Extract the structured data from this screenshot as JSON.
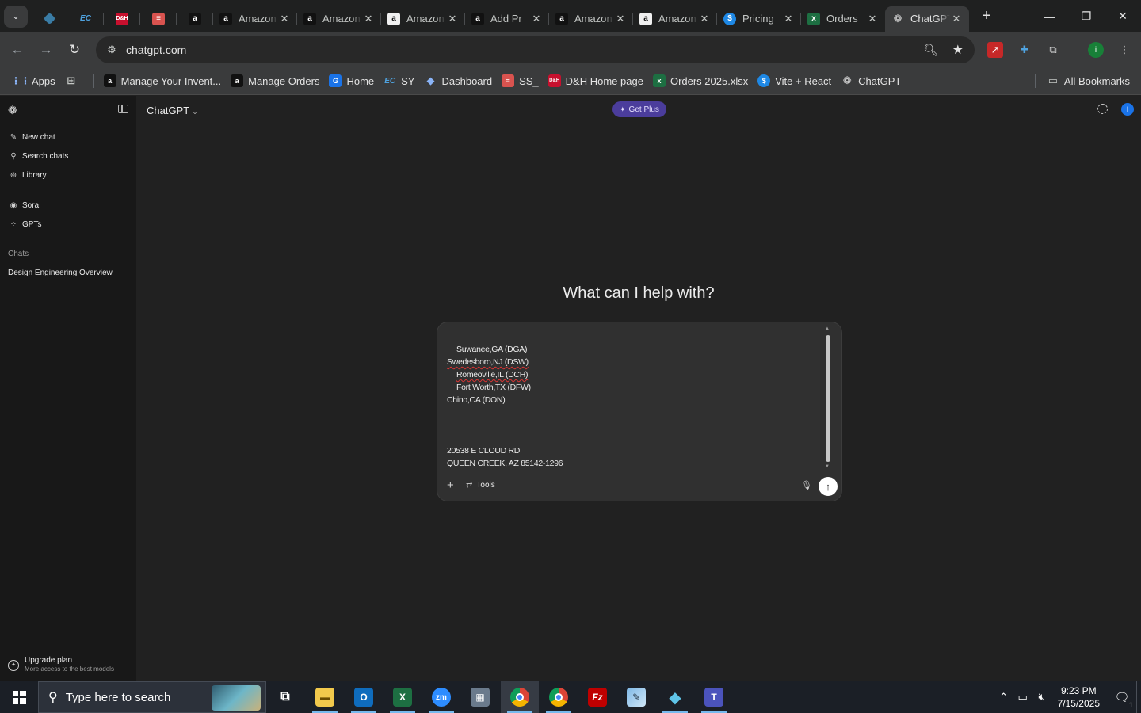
{
  "browser": {
    "tabs": [
      {
        "title": "",
        "favicon": "tab-search",
        "pinned": true
      },
      {
        "title": "",
        "favicon": "blue-diamond",
        "pinned": true
      },
      {
        "title": "",
        "favicon": "EC",
        "pinned": true
      },
      {
        "title": "",
        "favicon": "D&H",
        "pinned": true
      },
      {
        "title": "",
        "favicon": "stack",
        "pinned": true
      },
      {
        "title": "",
        "favicon": "amazon",
        "pinned": true
      },
      {
        "title": "Amazon",
        "favicon": "amazon"
      },
      {
        "title": "Amazon",
        "favicon": "amazon"
      },
      {
        "title": "Amazon",
        "favicon": "amazon"
      },
      {
        "title": "Add Pr",
        "favicon": "amazon"
      },
      {
        "title": "Amazon",
        "favicon": "amazon"
      },
      {
        "title": "Amazon",
        "favicon": "amazon"
      },
      {
        "title": "Pricing",
        "favicon": "dollar"
      },
      {
        "title": "Orders",
        "favicon": "excel"
      },
      {
        "title": "ChatGPT",
        "favicon": "openai",
        "active": true
      }
    ],
    "url": "chatgpt.com",
    "bookmarks": {
      "apps": "Apps",
      "items": [
        "Manage Your Invent...",
        "Manage Orders",
        "Home",
        "SY",
        "Dashboard",
        "SS_",
        "D&H Home page",
        "Orders 2025.xlsx",
        "Vite + React",
        "ChatGPT"
      ],
      "all": "All Bookmarks"
    }
  },
  "sidebar": {
    "items": [
      "New chat",
      "Search chats",
      "Library",
      "Sora",
      "GPTs"
    ],
    "section": "Chats",
    "chats": [
      "Design Engineering Overview"
    ],
    "upgrade_title": "Upgrade plan",
    "upgrade_sub": "More access to the best models"
  },
  "header": {
    "model": "ChatGPT",
    "get_plus": "Get Plus",
    "profile_initial": "I"
  },
  "hero": "What can I help with?",
  "composer": {
    "lines": [
      "Suwanee,GA (DGA)",
      "Swedesboro,NJ (DSW)",
      "Romeoville,IL (DCH)",
      "Fort Worth,TX (DFW)",
      "Chino,CA (DON)",
      "20538 E CLOUD RD",
      "QUEEN CREEK, AZ 85142-1296"
    ],
    "tools": "Tools"
  },
  "taskbar": {
    "search_placeholder": "Type here to search",
    "time": "9:23 PM",
    "date": "7/15/2025",
    "notification_count": "1"
  }
}
